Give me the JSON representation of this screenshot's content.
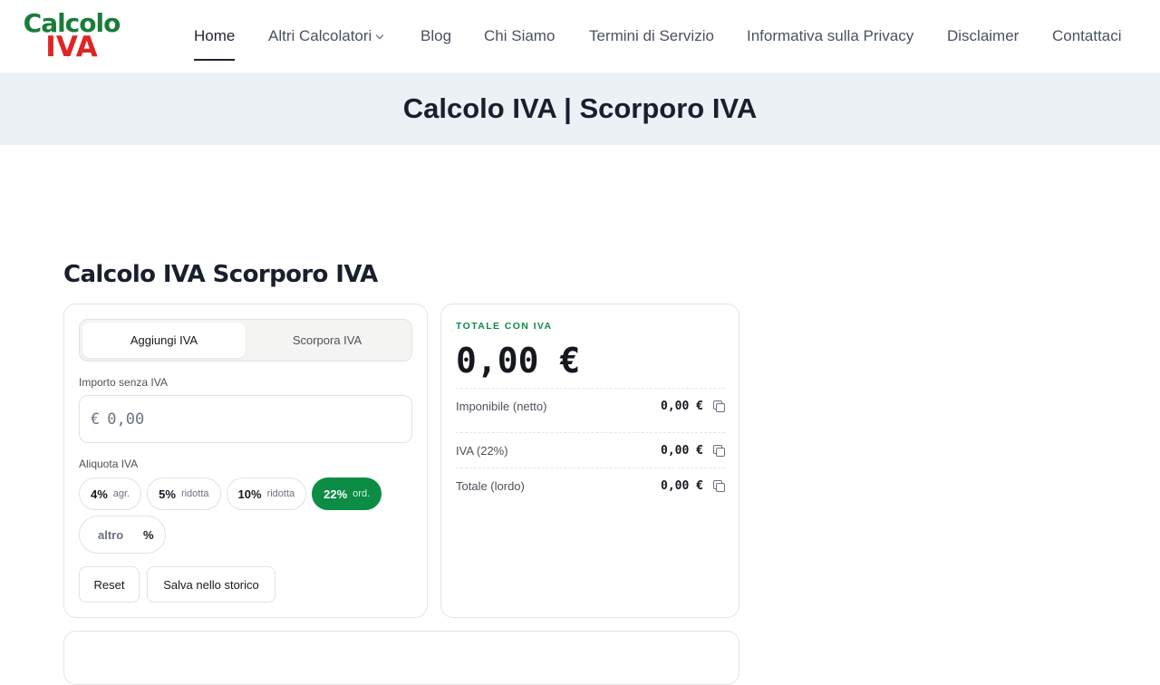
{
  "logo": {
    "line1": "Calcolo",
    "line2": "IVA"
  },
  "nav": {
    "items": [
      {
        "label": "Home",
        "active": true
      },
      {
        "label": "Altri Calcolatori",
        "has_dropdown": true
      },
      {
        "label": "Blog"
      },
      {
        "label": "Chi Siamo"
      },
      {
        "label": "Termini di Servizio"
      },
      {
        "label": "Informativa sulla Privacy"
      },
      {
        "label": "Disclaimer"
      },
      {
        "label": "Contattaci"
      }
    ]
  },
  "banner": {
    "title": "Calcolo IVA | Scorporo IVA"
  },
  "calculator": {
    "heading": "Calcolo IVA Scorporo IVA",
    "mode_tabs": [
      {
        "label": "Aggiungi IVA",
        "selected": true
      },
      {
        "label": "Scorpora IVA",
        "selected": false
      }
    ],
    "amount_label": "Importo senza IVA",
    "currency_symbol": "€",
    "amount_placeholder": "0,00",
    "rate_label": "Aliquota IVA",
    "rates": [
      {
        "pct": "4%",
        "sub": "agr.",
        "selected": false
      },
      {
        "pct": "5%",
        "sub": "ridotta",
        "selected": false
      },
      {
        "pct": "10%",
        "sub": "ridotta",
        "selected": false
      },
      {
        "pct": "22%",
        "sub": "ord.",
        "selected": true
      }
    ],
    "custom_rate_placeholder": "altro",
    "custom_rate_suffix": "%",
    "reset_label": "Reset",
    "save_label": "Salva nello storico"
  },
  "results": {
    "total_label": "TOTALE CON IVA",
    "total_value": "0,00 €",
    "rows": [
      {
        "label": "Imponibile (netto)",
        "value": "0,00 €"
      },
      {
        "label": "IVA (22%)",
        "value": "0,00 €"
      },
      {
        "label": "Totale (lordo)",
        "value": "0,00 €"
      }
    ]
  },
  "colors": {
    "brand_green": "#0b8d45",
    "logo_green": "#1a7c3a",
    "logo_red": "#e02424",
    "band_bg": "#ecf1f5"
  }
}
